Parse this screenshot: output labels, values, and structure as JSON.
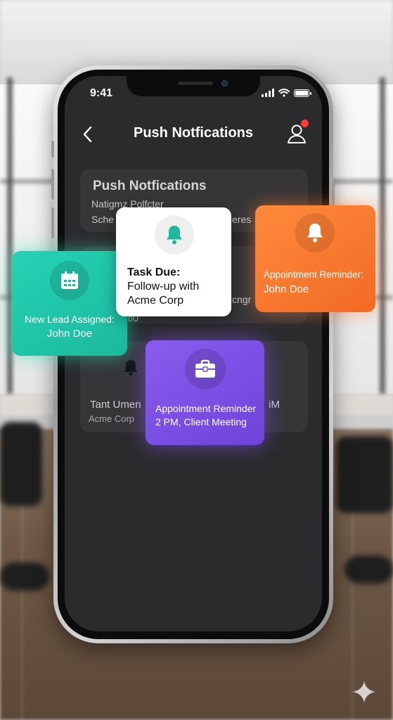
{
  "status_bar": {
    "time": "9:41"
  },
  "header": {
    "title": "Push Notfications"
  },
  "background_list": {
    "section_title": "Push Notfications",
    "row1_line1": "Natigmz Polfcter",
    "row1_line2": "Sche",
    "row1_line2_end": "eres",
    "row2_fragment": "cngr",
    "row2_sub": "oU",
    "row3_title_left": "Tant Umen",
    "row3_title_right": "iM",
    "row3_sub": "Acme Corp"
  },
  "notifications": {
    "new_lead": {
      "title": "New Lead Assigned:",
      "subtitle": "John Doe",
      "icon": "calendar-icon",
      "color": "#1fc4a6"
    },
    "task_due": {
      "title": "Task Due:",
      "line2": "Follow-up with",
      "line3": "Acme Corp",
      "icon": "bell-icon",
      "color": "#ffffff"
    },
    "appointment_orange": {
      "title": "Appointment Reminder:",
      "subtitle": "John Doe",
      "icon": "bell-icon",
      "color": "#f47a2e"
    },
    "appointment_purple": {
      "title": "Appointment Reminder",
      "subtitle": "2 PM, Client Meeting",
      "icon": "briefcase-icon",
      "color": "#7b50e6"
    }
  },
  "colors": {
    "notification_dot": "#ff3b30",
    "screen_bg": "#2b2b2d",
    "teal_accent": "#1fb89c"
  }
}
